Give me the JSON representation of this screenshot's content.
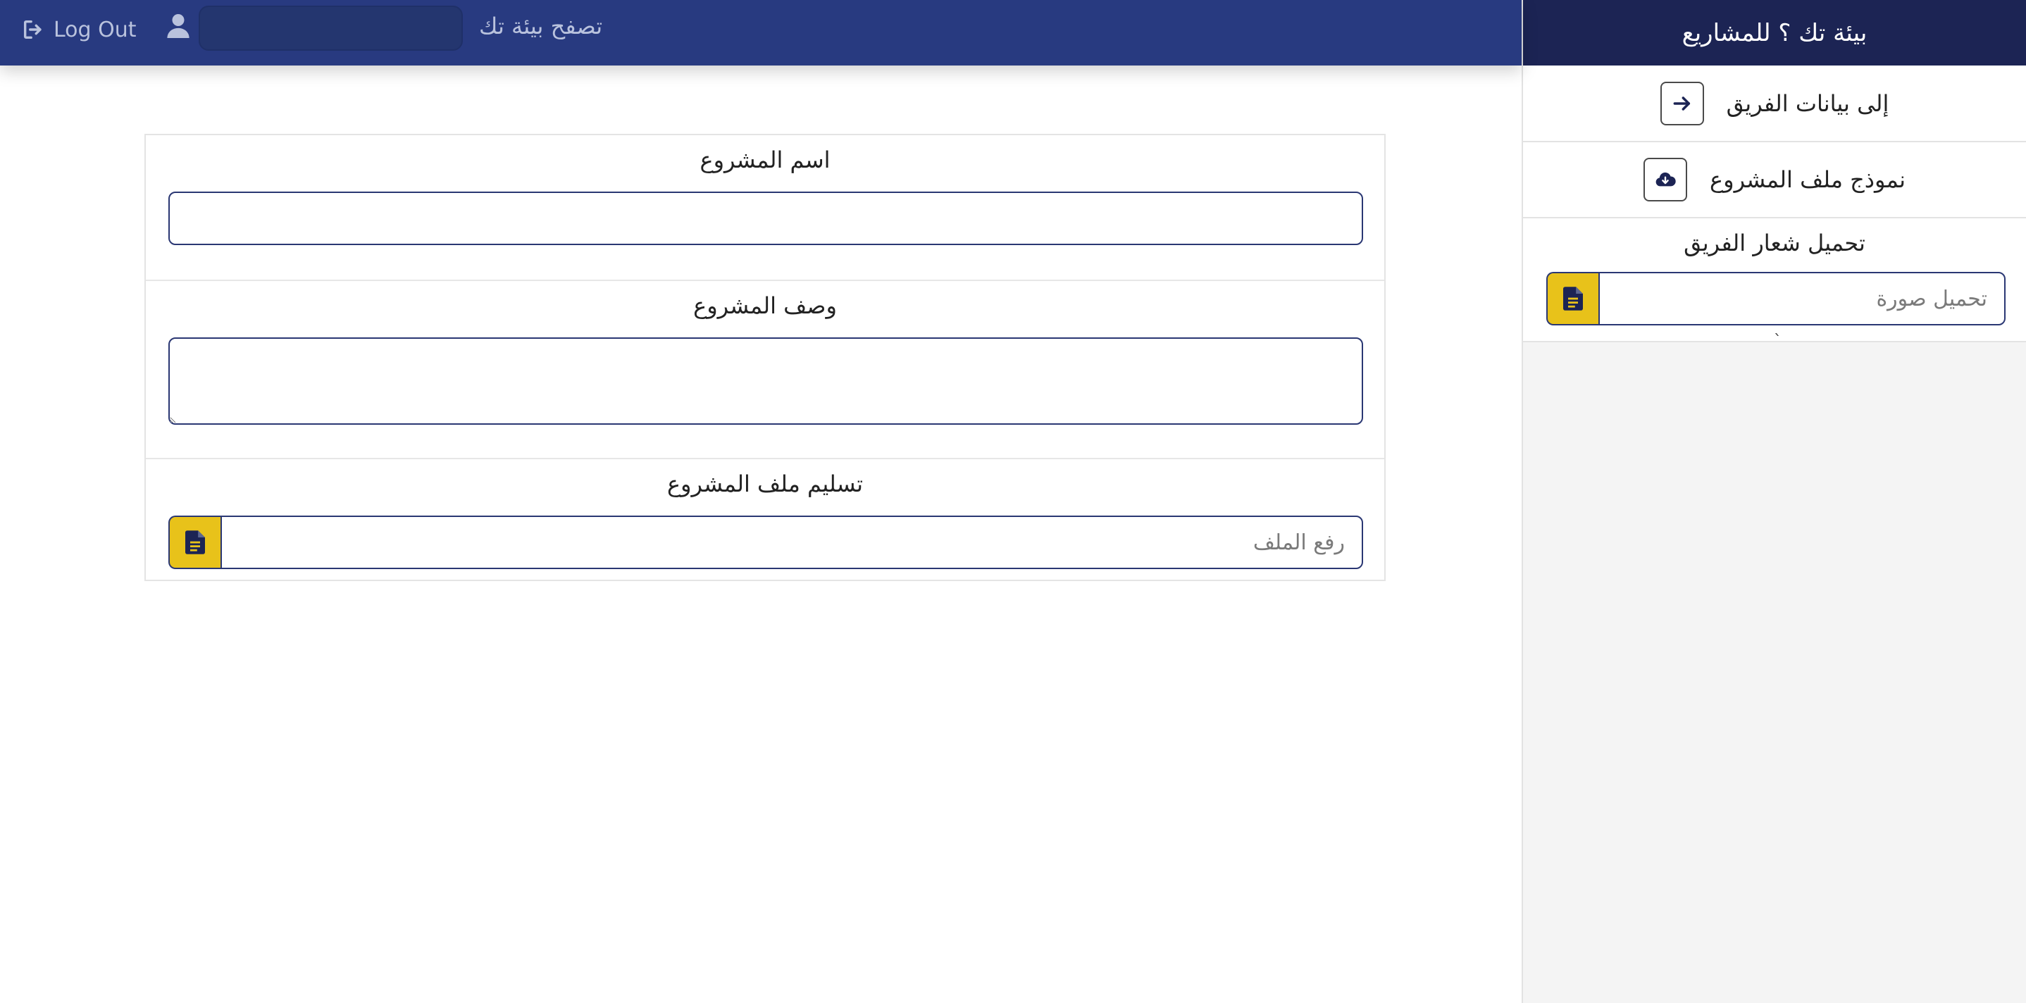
{
  "navbar": {
    "logout_label": "Log Out",
    "search_value": "",
    "title": "تصفح بيئة تك",
    "background": "#283a80"
  },
  "sidebar": {
    "header_title": "بيئة تك ؟ للمشاريع",
    "items": [
      {
        "label": "إلى بيانات الفريق",
        "icon": "arrow-right-icon"
      },
      {
        "label": "نموذج ملف المشروع",
        "icon": "cloud-download-icon"
      }
    ],
    "logo_upload": {
      "label": "تحميل شعار الفريق",
      "placeholder": "تحميل صورة",
      "icon": "file-icon"
    },
    "stray_mark": "`",
    "header_background": "#1c2454"
  },
  "form": {
    "project_name": {
      "label": "اسم المشروع",
      "value": ""
    },
    "project_description": {
      "label": "وصف المشروع",
      "value": ""
    },
    "project_file": {
      "label": "تسليم ملف المشروع",
      "placeholder": "رفع الملف",
      "icon": "file-icon"
    }
  },
  "colors": {
    "accent_yellow": "#e8c21a",
    "border_navy": "#2a3773"
  }
}
